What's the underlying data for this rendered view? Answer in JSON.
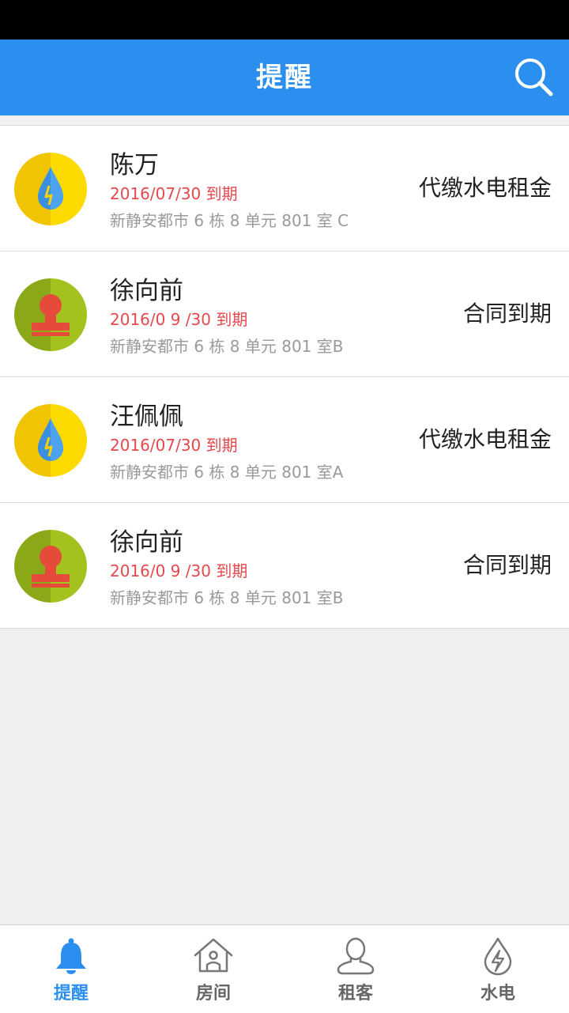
{
  "header": {
    "title": "提醒"
  },
  "reminders": [
    {
      "icon": "water-electric-icon",
      "name": "陈万",
      "due": "2016/07/30 到期",
      "address": "新静安都市 6 栋 8 单元 801 室 C",
      "tag": "代缴水电租金"
    },
    {
      "icon": "stamp-icon",
      "name": "徐向前",
      "due": "2016/0 9 /30 到期",
      "address": "新静安都市 6 栋 8 单元 801 室B",
      "tag": "合同到期"
    },
    {
      "icon": "water-electric-icon",
      "name": "汪佩佩",
      "due": "2016/07/30 到期",
      "address": "新静安都市 6 栋 8 单元 801 室A",
      "tag": "代缴水电租金"
    },
    {
      "icon": "stamp-icon",
      "name": "徐向前",
      "due": "2016/0 9 /30 到期",
      "address": "新静安都市 6 栋 8 单元 801 室B",
      "tag": "合同到期"
    }
  ],
  "tabs": [
    {
      "label": "提醒",
      "icon": "bell-icon",
      "active": true
    },
    {
      "label": "房间",
      "icon": "house-icon",
      "active": false
    },
    {
      "label": "租客",
      "icon": "person-icon",
      "active": false
    },
    {
      "label": "水电",
      "icon": "water-electric-outline-icon",
      "active": false
    }
  ],
  "colors": {
    "accent": "#2b8ff0",
    "due_red": "#e5484d",
    "water_yellow": "#f7cf00",
    "stamp_green": "#9cb81c"
  }
}
